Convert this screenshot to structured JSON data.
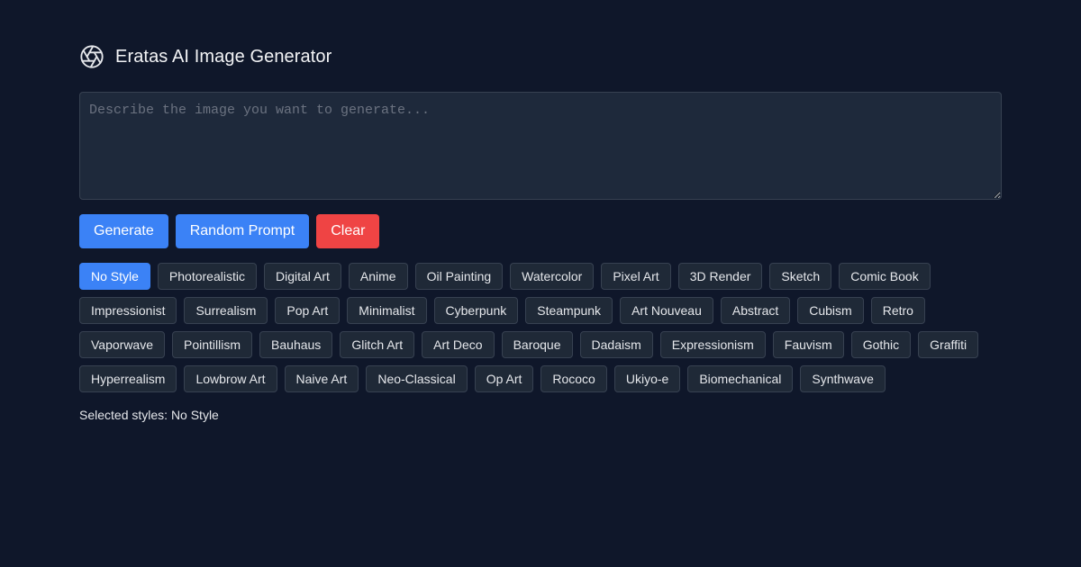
{
  "header": {
    "title": "Eratas AI Image Generator",
    "logo_icon": "aperture-icon"
  },
  "prompt": {
    "value": "",
    "placeholder": "Describe the image you want to generate..."
  },
  "actions": {
    "generate_label": "Generate",
    "random_label": "Random Prompt",
    "clear_label": "Clear"
  },
  "styles": [
    {
      "label": "No Style",
      "selected": true
    },
    {
      "label": "Photorealistic",
      "selected": false
    },
    {
      "label": "Digital Art",
      "selected": false
    },
    {
      "label": "Anime",
      "selected": false
    },
    {
      "label": "Oil Painting",
      "selected": false
    },
    {
      "label": "Watercolor",
      "selected": false
    },
    {
      "label": "Pixel Art",
      "selected": false
    },
    {
      "label": "3D Render",
      "selected": false
    },
    {
      "label": "Sketch",
      "selected": false
    },
    {
      "label": "Comic Book",
      "selected": false
    },
    {
      "label": "Impressionist",
      "selected": false
    },
    {
      "label": "Surrealism",
      "selected": false
    },
    {
      "label": "Pop Art",
      "selected": false
    },
    {
      "label": "Minimalist",
      "selected": false
    },
    {
      "label": "Cyberpunk",
      "selected": false
    },
    {
      "label": "Steampunk",
      "selected": false
    },
    {
      "label": "Art Nouveau",
      "selected": false
    },
    {
      "label": "Abstract",
      "selected": false
    },
    {
      "label": "Cubism",
      "selected": false
    },
    {
      "label": "Retro",
      "selected": false
    },
    {
      "label": "Vaporwave",
      "selected": false
    },
    {
      "label": "Pointillism",
      "selected": false
    },
    {
      "label": "Bauhaus",
      "selected": false
    },
    {
      "label": "Glitch Art",
      "selected": false
    },
    {
      "label": "Art Deco",
      "selected": false
    },
    {
      "label": "Baroque",
      "selected": false
    },
    {
      "label": "Dadaism",
      "selected": false
    },
    {
      "label": "Expressionism",
      "selected": false
    },
    {
      "label": "Fauvism",
      "selected": false
    },
    {
      "label": "Gothic",
      "selected": false
    },
    {
      "label": "Graffiti",
      "selected": false
    },
    {
      "label": "Hyperrealism",
      "selected": false
    },
    {
      "label": "Lowbrow Art",
      "selected": false
    },
    {
      "label": "Naive Art",
      "selected": false
    },
    {
      "label": "Neo-Classical",
      "selected": false
    },
    {
      "label": "Op Art",
      "selected": false
    },
    {
      "label": "Rococo",
      "selected": false
    },
    {
      "label": "Ukiyo-e",
      "selected": false
    },
    {
      "label": "Biomechanical",
      "selected": false
    },
    {
      "label": "Synthwave",
      "selected": false
    }
  ],
  "selected_text": "Selected styles: No Style",
  "colors": {
    "background": "#0f172a",
    "primary": "#3b82f6",
    "danger": "#ef4444",
    "chip_bg": "#1f2937",
    "input_bg": "#1e293b"
  }
}
